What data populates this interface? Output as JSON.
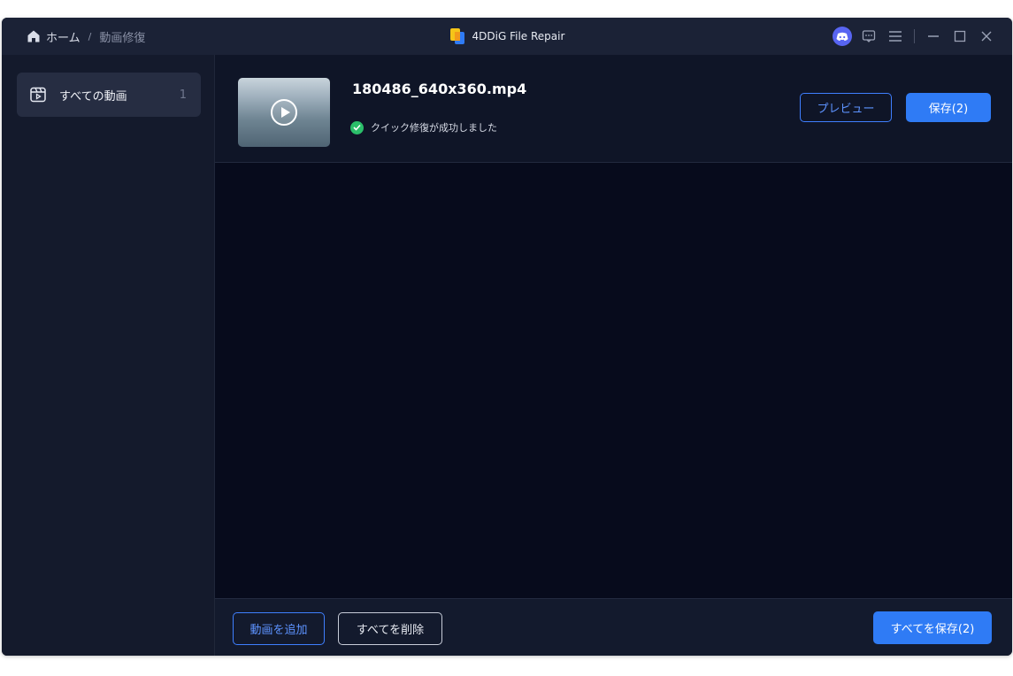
{
  "breadcrumb": {
    "home": "ホーム",
    "separator": "/",
    "current": "動画修復"
  },
  "app": {
    "title": "4DDiG File Repair"
  },
  "sidebar": {
    "items": [
      {
        "label": "すべての動画",
        "count": "1"
      }
    ]
  },
  "file": {
    "name": "180486_640x360.mp4",
    "status": "クイック修復が成功しました",
    "preview_label": "プレビュー",
    "save_label": "保存(2)"
  },
  "footer": {
    "add_label": "動画を追加",
    "delete_label": "すべてを削除",
    "save_all_label": "すべてを保存(2)"
  },
  "colors": {
    "accent": "#2f7bf5",
    "success": "#2bbf6a",
    "background": "#070b1c",
    "panel": "#141a2c"
  },
  "icons": [
    "home-icon",
    "app-logo-icon",
    "discord-icon",
    "feedback-icon",
    "menu-icon",
    "minimize-icon",
    "maximize-icon",
    "close-icon",
    "video-library-icon",
    "play-icon",
    "check-icon"
  ]
}
